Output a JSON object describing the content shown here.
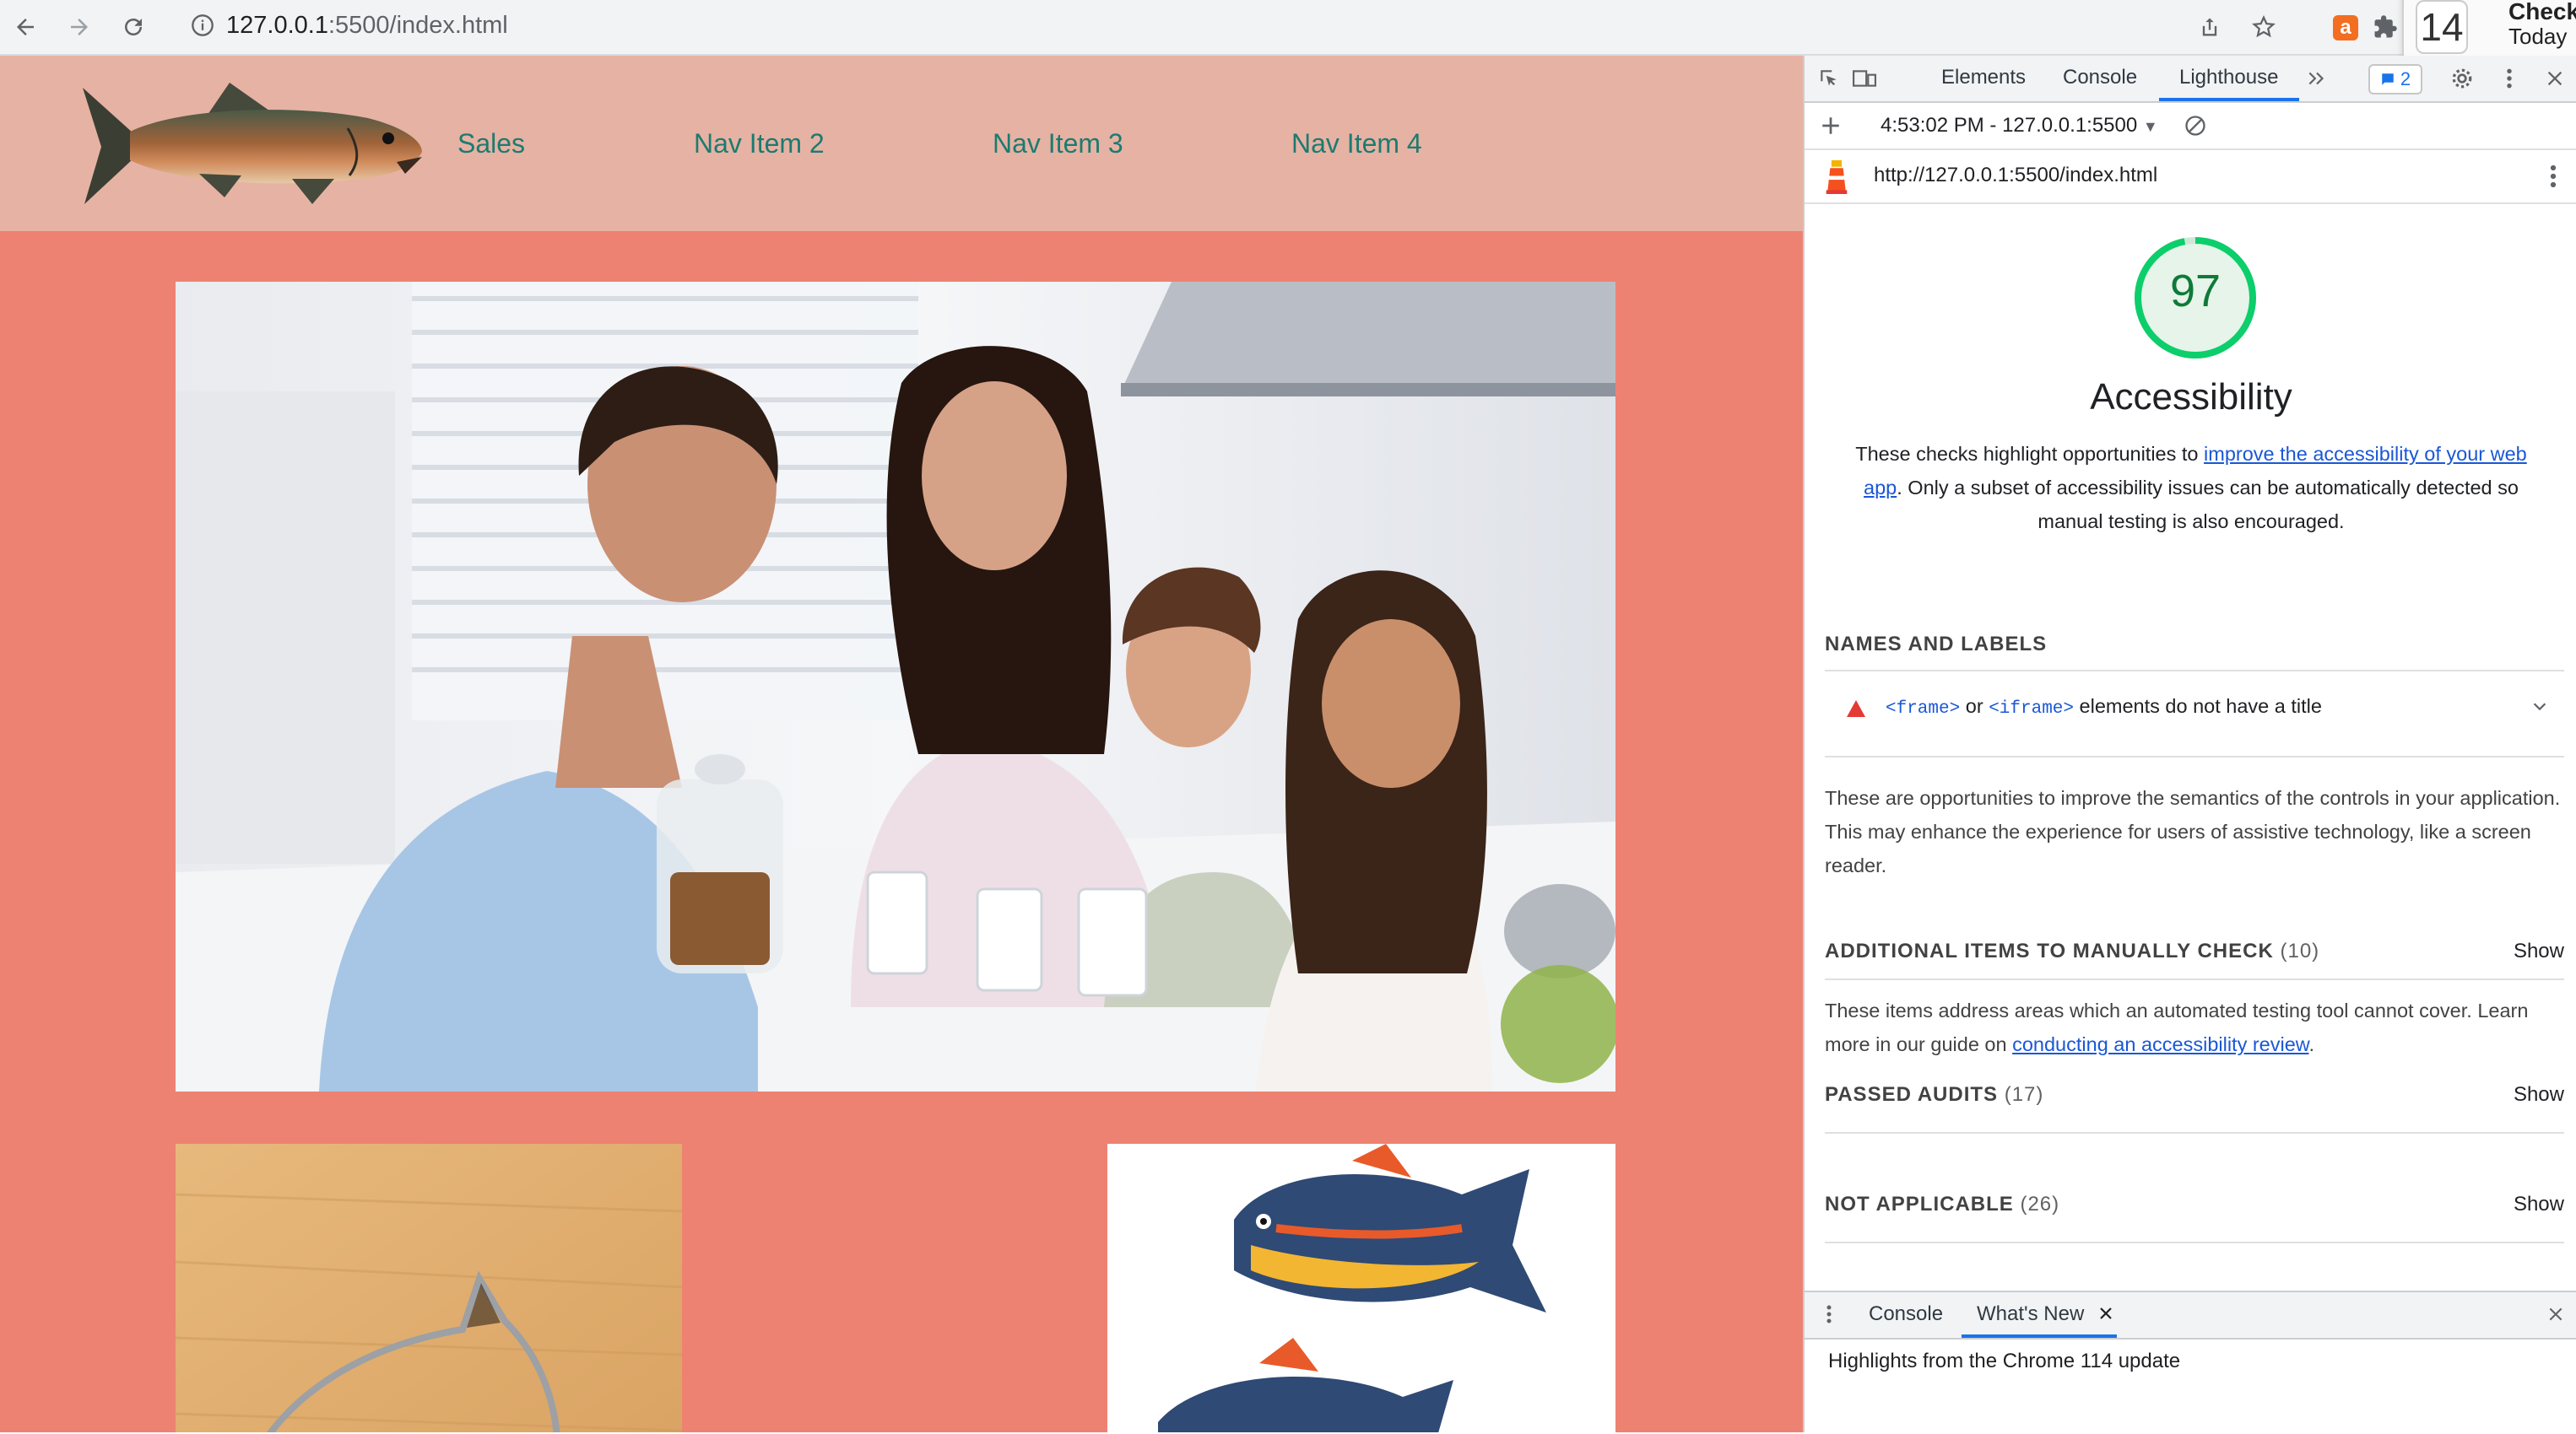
{
  "browser": {
    "url_host": "127.0.0.1",
    "url_rest": ":5500/index.html",
    "notification": {
      "count": "14",
      "title": "Check",
      "subtitle": "Today"
    }
  },
  "site": {
    "nav": [
      "Sales",
      "Nav Item 2",
      "Nav Item 3",
      "Nav Item 4"
    ]
  },
  "devtools": {
    "tabs": {
      "elements": "Elements",
      "console": "Console",
      "lighthouse": "Lighthouse"
    },
    "message_count": "2",
    "report_select": "4:53:02 PM - 127.0.0.1:5500",
    "report_url": "http://127.0.0.1:5500/index.html",
    "score": "97",
    "score_fraction": 0.97,
    "category": "Accessibility",
    "desc_before": "These checks highlight opportunities to ",
    "desc_link": "improve the accessibility of your web app",
    "desc_after": ". Only a subset of accessibility issues can be automatically detected so manual testing is also encouraged.",
    "names_labels_title": "NAMES AND LABELS",
    "audit": {
      "code1": "<frame>",
      "or": " or ",
      "code2": "<iframe>",
      "rest": " elements do not have a title"
    },
    "names_labels_desc": "These are opportunities to improve the semantics of the controls in your application. This may enhance the experience for users of assistive technology, like a screen reader.",
    "manual_title": "ADDITIONAL ITEMS TO MANUALLY CHECK",
    "manual_count": "(10)",
    "manual_desc_before": "These items address areas which an automated testing tool cannot cover. Learn more in our guide on ",
    "manual_desc_link": "conducting an accessibility review",
    "manual_desc_after": ".",
    "passed_title": "PASSED AUDITS",
    "passed_count": "(17)",
    "na_title": "NOT APPLICABLE",
    "na_count": "(26)",
    "show_label": "Show",
    "drawer": {
      "console": "Console",
      "whats_new": "What's New",
      "content": "Highlights from the Chrome 114 update"
    }
  },
  "colors": {
    "page_bg": "#ed8272",
    "header_bg": "#e6b2a4",
    "nav_text": "#1c7b6f",
    "score_green": "#0cce6b"
  }
}
